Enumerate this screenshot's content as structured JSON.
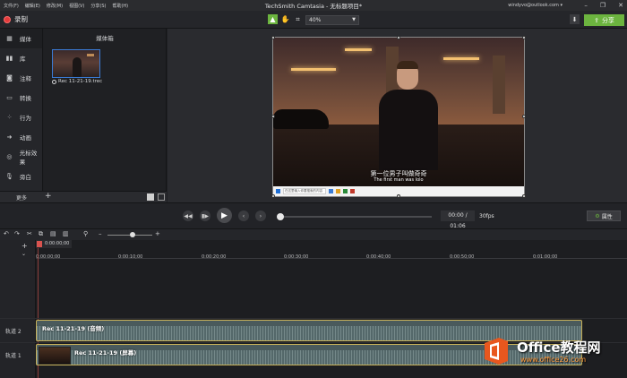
{
  "menubar": {
    "items": [
      "文件(F)",
      "编辑(E)",
      "修改(M)",
      "视图(V)",
      "分享(S)",
      "帮助(H)"
    ]
  },
  "window": {
    "title": "TechSmith Camtasia - 无标题项目*",
    "account": "windyvo@outlook.com ▾"
  },
  "toolbar": {
    "record_label": "录制",
    "zoom_value": "40%",
    "share_label": "分享"
  },
  "leftnav": {
    "items": [
      {
        "label": "媒体",
        "icon": "media-icon"
      },
      {
        "label": "库",
        "icon": "library-icon"
      },
      {
        "label": "注释",
        "icon": "annotation-icon"
      },
      {
        "label": "转换",
        "icon": "transition-icon"
      },
      {
        "label": "行为",
        "icon": "behavior-icon"
      },
      {
        "label": "动画",
        "icon": "animation-icon"
      },
      {
        "label": "光标效果",
        "icon": "cursor-effect-icon"
      },
      {
        "label": "旁白",
        "icon": "microphone-icon"
      }
    ],
    "more_label": "更多"
  },
  "mediabin": {
    "title": "媒体箱",
    "clip_label": "Rec 11-21-19.trec"
  },
  "video": {
    "caption_cn": "第一位男子叫做奇奇",
    "caption_en": "The first man was lolo",
    "search_text": "在这里输入你要搜索的内容"
  },
  "playback": {
    "timecode": "00:00 / 01:06",
    "fps": "30fps",
    "properties_label": "属性"
  },
  "timeline": {
    "playhead_time": "0:00:00;00",
    "ticks": [
      "0:00:00;00",
      "0:00:10;00",
      "0:00:20;00",
      "0:00:30;00",
      "0:00:40;00",
      "0:00:50;00",
      "0:01:00;00"
    ],
    "tracks": [
      {
        "label": "轨道 2",
        "clip_name": "Rec 11-21-19 (音频)"
      },
      {
        "label": "轨道 1",
        "clip_name": "Rec 11-21-19 (屏幕)"
      }
    ]
  },
  "watermark": {
    "title": "Office教程网",
    "url": "www.office26.com"
  },
  "colors": {
    "accent_green": "#6cb43f",
    "record_red": "#e33b3b",
    "clip_border": "#c9b25a",
    "watermark_orange": "#ff9a3c"
  }
}
